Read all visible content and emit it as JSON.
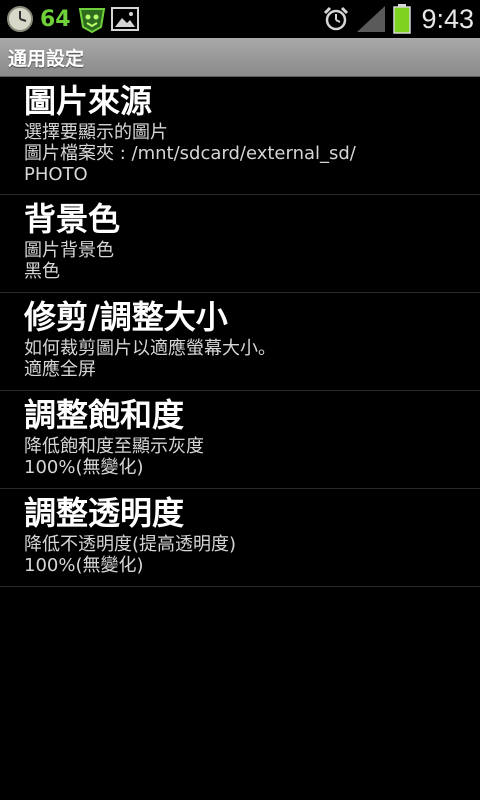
{
  "status_bar": {
    "count": "64",
    "time": "9:43",
    "icons": [
      "clock-icon",
      "bug-icon",
      "image-icon",
      "alarm-icon",
      "signal-icon",
      "battery-icon"
    ],
    "accent_color": "#6fd13a",
    "battery_color": "#7ed321"
  },
  "title_bar": {
    "title": "通用設定"
  },
  "settings": [
    {
      "title": "圖片來源",
      "summary": "選擇要顯示的圖片",
      "path": "圖片檔案夾 : /mnt/sdcard/external_sd/",
      "value": "PHOTO"
    },
    {
      "title": "背景色",
      "summary": "圖片背景色",
      "value": "黑色"
    },
    {
      "title": "修剪/調整大小",
      "summary": "如何裁剪圖片以適應螢幕大小。",
      "value": "適應全屏"
    },
    {
      "title": "調整飽和度",
      "summary": "降低飽和度至顯示灰度",
      "value": "100%(無變化)"
    },
    {
      "title": "調整透明度",
      "summary": "降低不透明度(提高透明度)",
      "value": "100%(無變化)"
    }
  ]
}
